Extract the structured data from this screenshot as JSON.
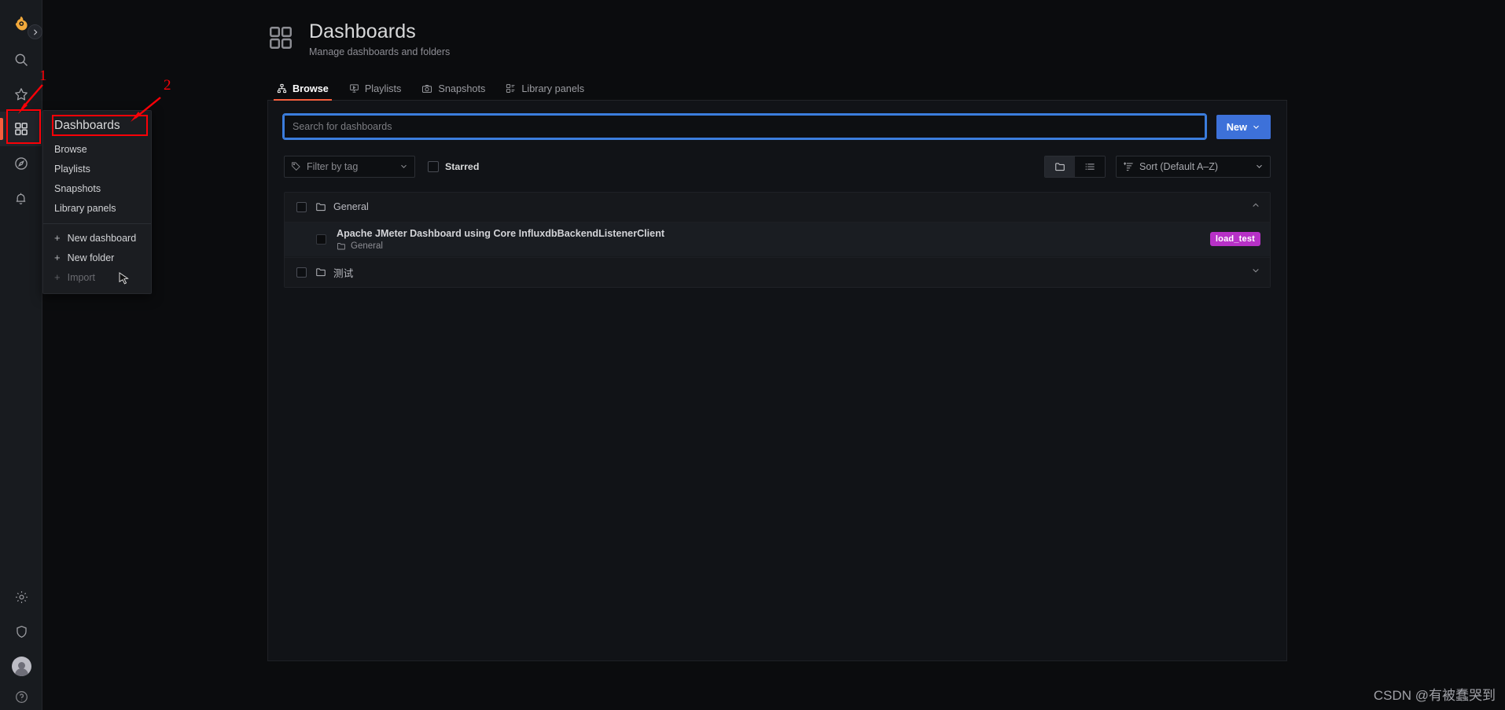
{
  "app": {
    "brand_icon": "grafana-logo-icon",
    "accent_orange": "#f55f3e",
    "accent_blue": "#3d71d9",
    "tag_purple": "#b731c7"
  },
  "nav_rail": {
    "items": [
      {
        "name": "grafana-logo-icon",
        "label": "Grafana"
      },
      {
        "name": "search-icon",
        "label": "Search"
      },
      {
        "name": "star-icon",
        "label": "Starred"
      },
      {
        "name": "dashboards-icon",
        "label": "Dashboards"
      },
      {
        "name": "explore-icon",
        "label": "Explore"
      },
      {
        "name": "alerting-bell-icon",
        "label": "Alerting"
      }
    ],
    "bottom_items": [
      {
        "name": "gear-icon",
        "label": "Configuration"
      },
      {
        "name": "shield-icon",
        "label": "Server Admin"
      },
      {
        "name": "avatar",
        "label": "Profile"
      },
      {
        "name": "help-icon",
        "label": "Help"
      }
    ],
    "expand_chip": "chevron-right-icon"
  },
  "mega_menu": {
    "header": "Dashboards",
    "items": [
      {
        "label": "Browse"
      },
      {
        "label": "Playlists"
      },
      {
        "label": "Snapshots"
      },
      {
        "label": "Library panels"
      }
    ],
    "actions": [
      {
        "label": "New dashboard",
        "plus": "+",
        "dim": false
      },
      {
        "label": "New folder",
        "plus": "+",
        "dim": false
      },
      {
        "label": "Import",
        "plus": "+",
        "dim": true
      }
    ]
  },
  "header": {
    "icon": "dashboards-grid-icon",
    "title": "Dashboards",
    "subtitle": "Manage dashboards and folders"
  },
  "tabs": [
    {
      "label": "Browse",
      "icon": "sitemap-icon",
      "active": true
    },
    {
      "label": "Playlists",
      "icon": "presentation-play-icon",
      "active": false
    },
    {
      "label": "Snapshots",
      "icon": "camera-icon",
      "active": false
    },
    {
      "label": "Library panels",
      "icon": "library-panel-icon",
      "active": false
    }
  ],
  "search": {
    "placeholder": "Search for dashboards",
    "value": ""
  },
  "new_button": {
    "label": "New",
    "chevron": "chevron-down-icon"
  },
  "filters": {
    "tag_filter": {
      "placeholder": "Filter by tag",
      "icon": "tag-icon",
      "chevron": "chevron-down-icon"
    },
    "starred": {
      "label": "Starred",
      "checked": false
    },
    "view_toggle": {
      "folder_view": "folder-icon",
      "list_view": "list-icon",
      "active": "folder_view"
    },
    "sort": {
      "label": "Sort (Default A–Z)",
      "icon": "sort-amount-up-icon",
      "chevron": "chevron-down-icon"
    }
  },
  "results": {
    "folders": [
      {
        "name": "General",
        "icon": "folder-icon",
        "expanded": true,
        "chevron": "chevron-up-icon",
        "dashboards": [
          {
            "title": "Apache JMeter Dashboard using Core InfluxdbBackendListenerClient",
            "folder": "General",
            "folder_icon": "folder-icon",
            "tag": "load_test"
          }
        ]
      },
      {
        "name": "测试",
        "icon": "folder-icon",
        "expanded": false,
        "chevron": "chevron-down-icon",
        "dashboards": []
      }
    ]
  },
  "annotations": [
    {
      "num": "1",
      "target": "dashboards-rail-icon"
    },
    {
      "num": "2",
      "target": "dashboards-menu-header"
    }
  ],
  "watermark": "CSDN @有被蠢哭到"
}
